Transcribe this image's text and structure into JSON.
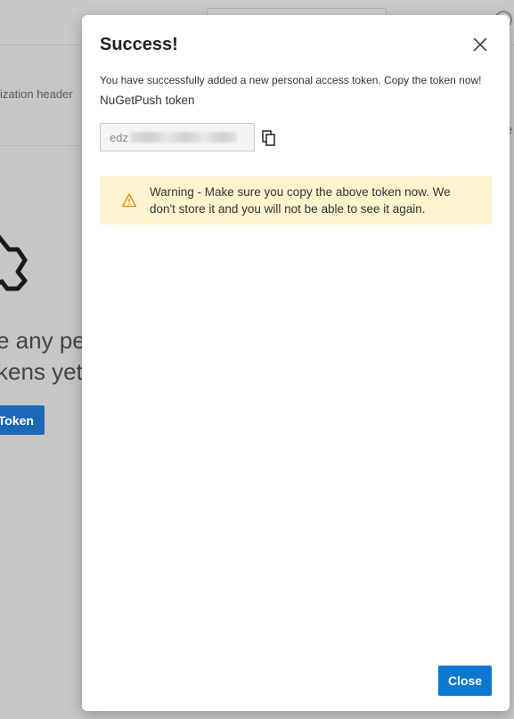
{
  "background": {
    "auth_header_text": "ization header",
    "right_edge_text": "e",
    "empty_state_line1": "e any pe",
    "empty_state_line2": "kens yet.",
    "new_token_button_label": "Token"
  },
  "dialog": {
    "title": "Success!",
    "message": "You have successfully added a new personal access token. Copy the token now!",
    "token_name": "NuGetPush token",
    "token_value_prefix": "edz",
    "warning_text": "Warning - Make sure you copy the above token now. We don't store it and you will not be able to see it again.",
    "close_button_label": "Close"
  },
  "icons": {
    "close": "close-icon",
    "copy": "copy-icon",
    "warning": "warning-icon",
    "key": "key-icon"
  },
  "colors": {
    "primary": "#0b78d0",
    "warning_bg": "#fff4ce",
    "warning_icon": "#e08a17",
    "overlay": "#c6c6c6"
  }
}
